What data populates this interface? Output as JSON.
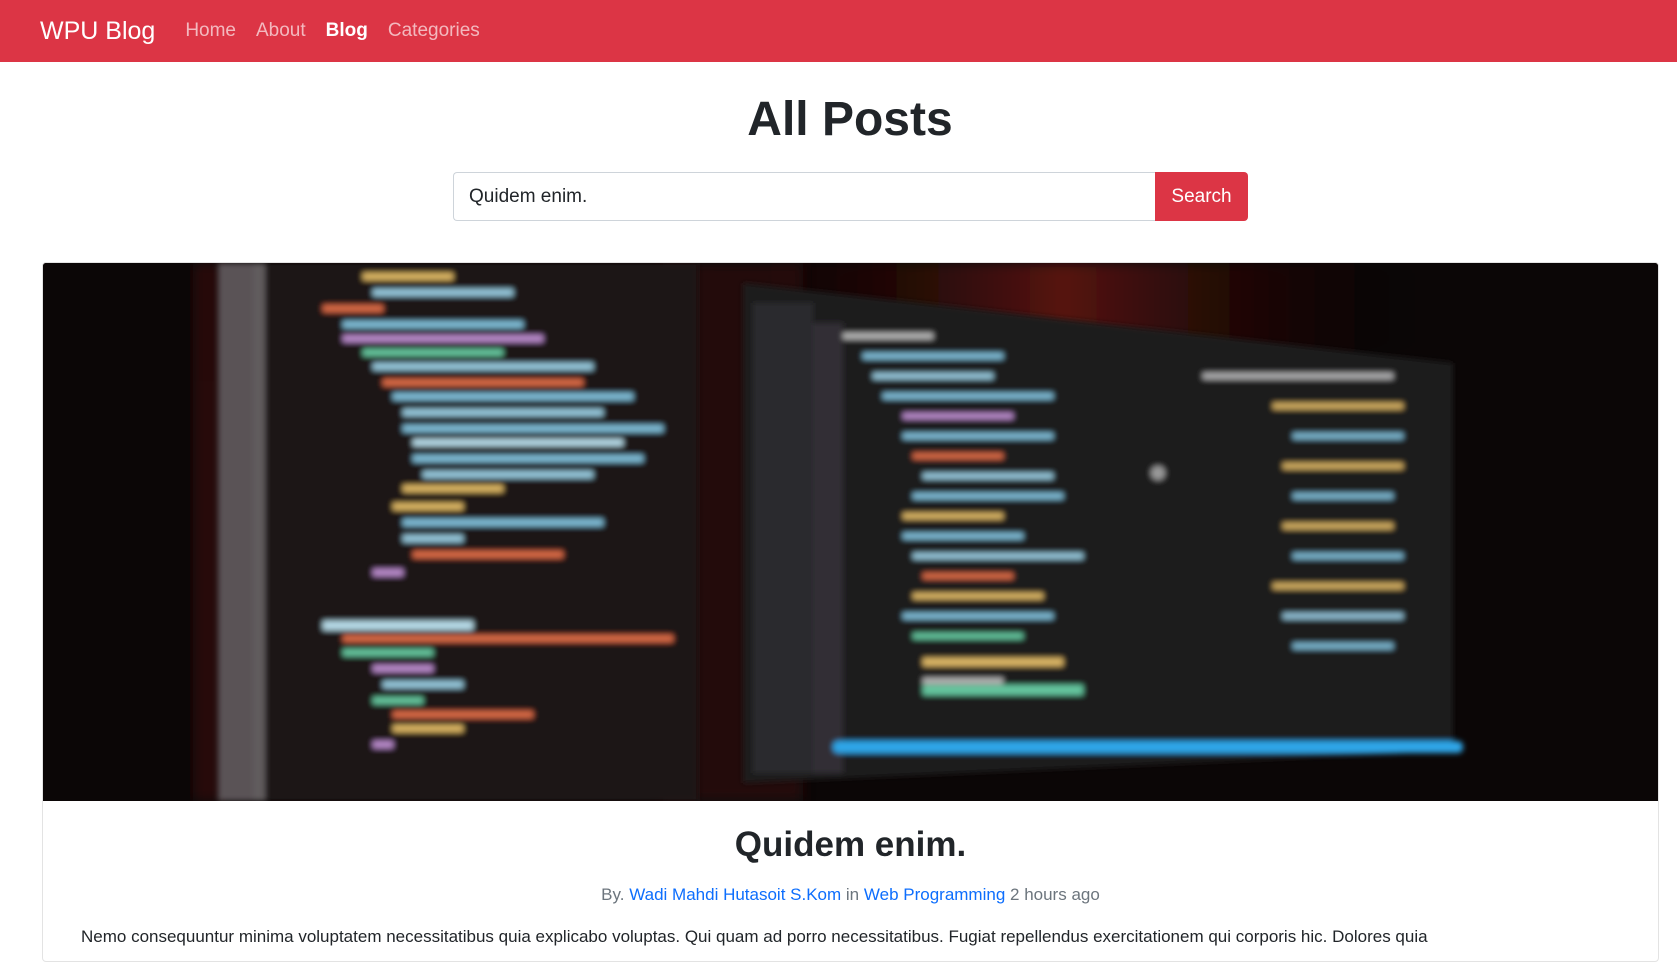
{
  "navbar": {
    "brand": "WPU Blog",
    "links": [
      {
        "label": "Home",
        "active": false
      },
      {
        "label": "About",
        "active": false
      },
      {
        "label": "Blog",
        "active": true
      },
      {
        "label": "Categories",
        "active": false
      }
    ]
  },
  "page_title": "All Posts",
  "search": {
    "value": "Quidem enim.",
    "button_label": "Search"
  },
  "post": {
    "title": "Quidem enim.",
    "by_prefix": "By.",
    "author": "Wadi Mahdi Hutasoit S.Kom",
    "in_word": "in",
    "category": "Web Programming",
    "time": "2 hours ago",
    "excerpt": "Nemo consequuntur minima voluptatem necessitatibus quia explicabo voluptas. Qui quam ad porro necessitatibus. Fugiat repellendus exercitationem qui corporis hic. Dolores quia"
  },
  "colors": {
    "accent": "#dc3545",
    "link": "#0d6efd"
  }
}
